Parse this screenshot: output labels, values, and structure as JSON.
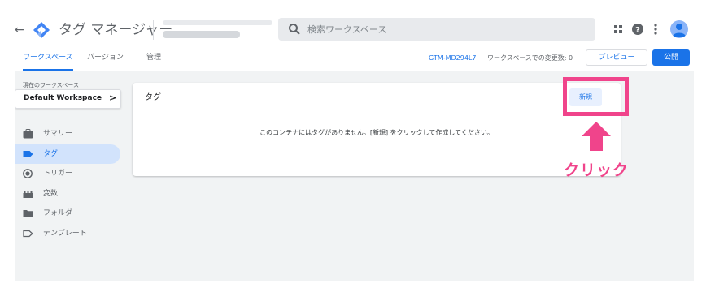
{
  "header": {
    "app_title": "タグ マネージャー",
    "search_placeholder": "検索ワークスペース"
  },
  "tabs": [
    {
      "label": "ワークスペース",
      "active": true
    },
    {
      "label": "バージョン",
      "active": false
    },
    {
      "label": "管理",
      "active": false
    }
  ],
  "toolbar": {
    "container_id": "GTM-MD294L7",
    "changes_text": "ワークスペースでの変更数: 0",
    "preview_label": "プレビュー",
    "publish_label": "公開"
  },
  "workspace": {
    "label": "現在のワークスペース",
    "name": "Default Workspace",
    "chevron": ">"
  },
  "sidebar": {
    "items": [
      {
        "label": "サマリー",
        "icon": "briefcase-icon",
        "active": false
      },
      {
        "label": "タグ",
        "icon": "tag-icon",
        "active": true
      },
      {
        "label": "トリガー",
        "icon": "trigger-icon",
        "active": false
      },
      {
        "label": "変数",
        "icon": "variables-icon",
        "active": false
      },
      {
        "label": "フォルダ",
        "icon": "folder-icon",
        "active": false
      },
      {
        "label": "テンプレート",
        "icon": "template-icon",
        "active": false
      }
    ]
  },
  "main": {
    "card_title": "タグ",
    "empty_message": "このコンテナにはタグがありません。[新規] をクリックして作成してください。",
    "new_button_label": "新規"
  },
  "annotation": {
    "label": "クリック",
    "color": "#f0448b"
  },
  "colors": {
    "accent": "#1a73e8",
    "highlight": "#f0448b"
  }
}
